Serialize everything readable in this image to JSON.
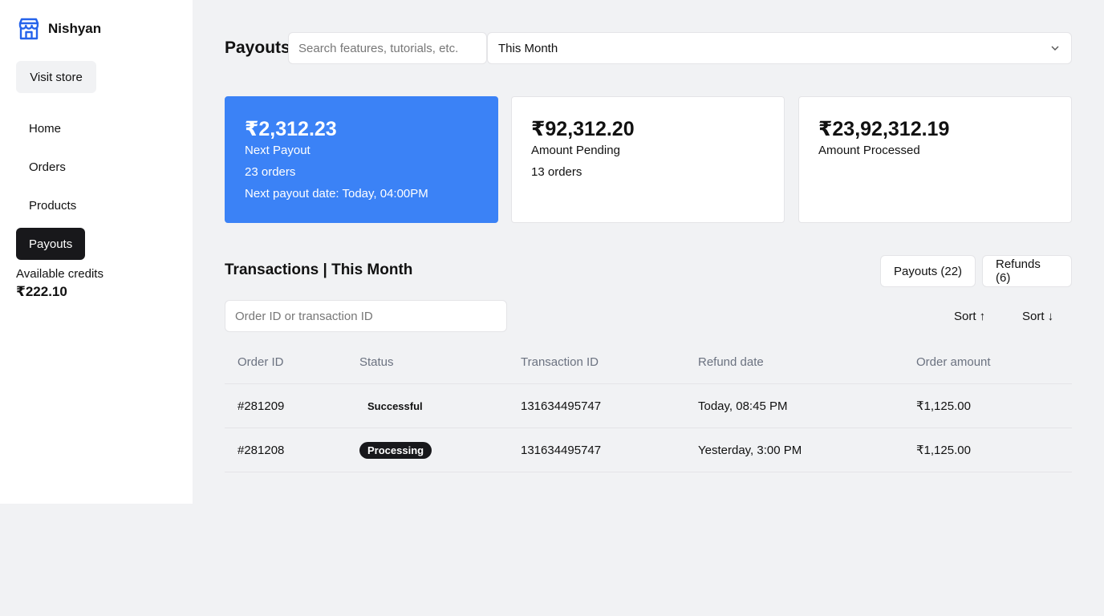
{
  "brand": {
    "name": "Nishyan",
    "icon": "store-icon",
    "accent": "#2563eb"
  },
  "sidebar": {
    "visit_store": "Visit store",
    "items": [
      {
        "label": "Home"
      },
      {
        "label": "Orders"
      },
      {
        "label": "Products"
      },
      {
        "label": "Payouts",
        "active": true
      }
    ],
    "credits_label": "Available credits",
    "credits_value": "₹222.10"
  },
  "header": {
    "title": "Payouts",
    "search_placeholder": "Search features, tutorials, etc.",
    "period": "This Month"
  },
  "cards": [
    {
      "amount": "₹2,312.23",
      "label": "Next Payout",
      "orders": "23 orders",
      "extra": "Next payout date: Today, 04:00PM",
      "color": "#3b82f6"
    },
    {
      "amount": "₹92,312.20",
      "label": "Amount Pending",
      "orders": "13 orders"
    },
    {
      "amount": "₹23,92,312.19",
      "label": "Amount Processed"
    }
  ],
  "transactions": {
    "title": "Transactions | This Month",
    "tabs": {
      "payouts": "Payouts (22)",
      "refunds": "Refunds (6)"
    },
    "search_placeholder": "Order ID or transaction ID",
    "sort_asc": "Sort ↑",
    "sort_desc": "Sort ↓",
    "columns": [
      "Order ID",
      "Status",
      "Transaction ID",
      "Refund date",
      "Order amount"
    ],
    "rows": [
      {
        "order_id": "#281209",
        "status": "Successful",
        "transaction_id": "131634495747",
        "refund_date": "Today, 08:45 PM",
        "amount": "₹1,125.00"
      },
      {
        "order_id": "#281208",
        "status": "Processing",
        "transaction_id": "131634495747",
        "refund_date": "Yesterday, 3:00 PM",
        "amount": "₹1,125.00"
      }
    ]
  }
}
